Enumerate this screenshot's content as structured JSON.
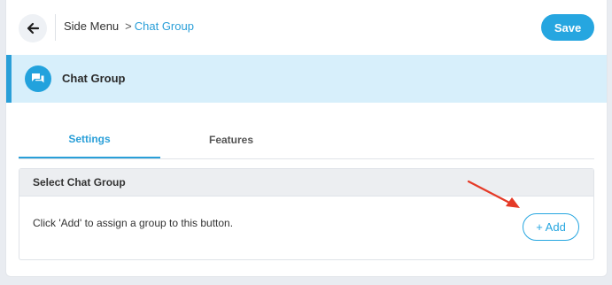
{
  "header": {
    "back_icon": "arrow-left-icon",
    "breadcrumb": {
      "root": "Side Menu",
      "separator": ">",
      "current": "Chat Group"
    },
    "save_label": "Save"
  },
  "title_bar": {
    "icon": "chat-bubbles-icon",
    "title": "Chat Group"
  },
  "tabs": [
    {
      "label": "Settings",
      "active": true
    },
    {
      "label": "Features",
      "active": false
    }
  ],
  "section": {
    "title": "Select Chat Group",
    "hint": "Click 'Add' to assign a group to this button.",
    "add_label": "+ Add"
  },
  "colors": {
    "accent": "#26a6e0",
    "title_bar_bg": "#d7effb",
    "annotation_arrow": "#e53a27"
  }
}
